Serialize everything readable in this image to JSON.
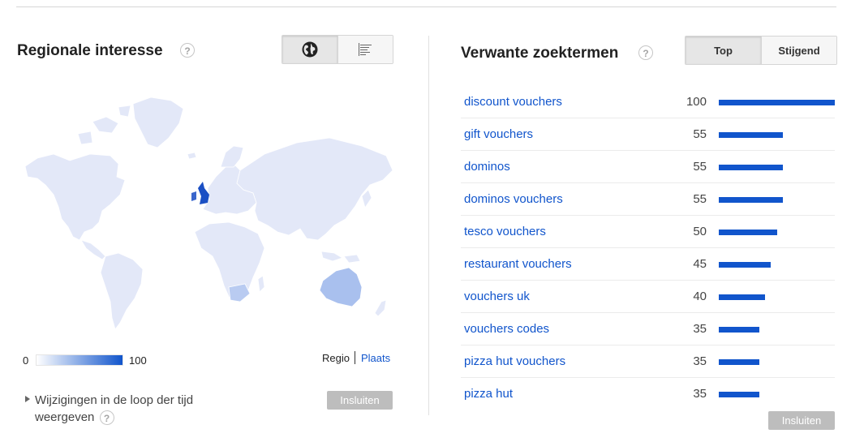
{
  "regional": {
    "title": "Regionale interesse",
    "help": "?",
    "legend_min": "0",
    "legend_max": "100",
    "regio": "Regio",
    "plaats": "Plaats",
    "changes_text": "Wijzigingen in de loop der tijd weergeven",
    "embed_label": "Insluiten"
  },
  "related": {
    "title": "Verwante zoektermen",
    "help": "?",
    "tab_top": "Top",
    "tab_rising": "Stijgend",
    "embed_label": "Insluiten",
    "items": [
      {
        "term": "discount vouchers",
        "value": 100
      },
      {
        "term": "gift vouchers",
        "value": 55
      },
      {
        "term": "dominos",
        "value": 55
      },
      {
        "term": "dominos vouchers",
        "value": 55
      },
      {
        "term": "tesco vouchers",
        "value": 50
      },
      {
        "term": "restaurant vouchers",
        "value": 45
      },
      {
        "term": "vouchers uk",
        "value": 40
      },
      {
        "term": "vouchers codes",
        "value": 35
      },
      {
        "term": "pizza hut vouchers",
        "value": 35
      },
      {
        "term": "pizza hut",
        "value": 35
      }
    ]
  },
  "colors": {
    "accent": "#1155cc",
    "land": "#e3e8f8",
    "australia": "#a9c0ee",
    "south_africa": "#b9cbf1",
    "uk": "#1a4fc4",
    "button_grey": "#bdbdbd"
  },
  "icons": {
    "globe": "globe-icon",
    "list": "bar-list-icon",
    "expand": "expand-triangle-icon"
  }
}
